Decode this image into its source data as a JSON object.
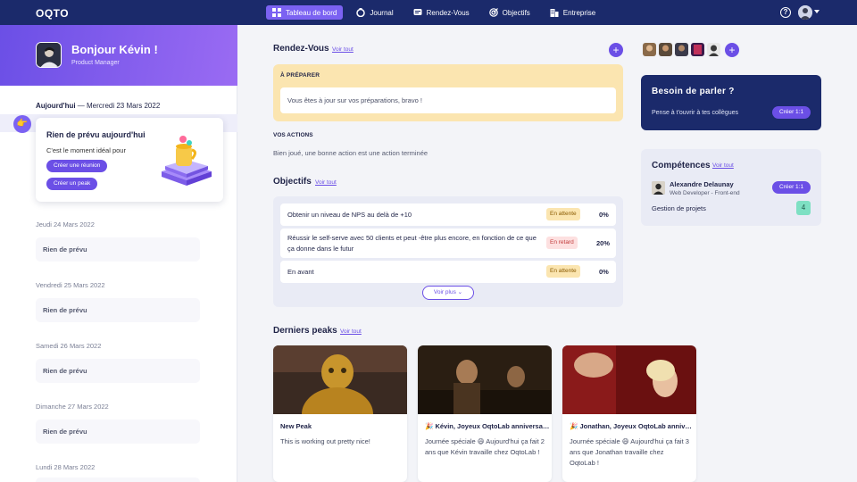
{
  "brand": "OQTO",
  "nav": {
    "items": [
      {
        "label": "Tableau de bord",
        "icon": "dashboard-icon",
        "active": true
      },
      {
        "label": "Journal",
        "icon": "journal-icon"
      },
      {
        "label": "Rendez-Vous",
        "icon": "meeting-icon"
      },
      {
        "label": "Objectifs",
        "icon": "target-icon"
      },
      {
        "label": "Entreprise",
        "icon": "company-icon"
      }
    ],
    "help": "?"
  },
  "hero": {
    "greeting": "Bonjour Kévin !",
    "role": "Product Manager"
  },
  "agenda": {
    "today_prefix": "Aujourd'hui",
    "today_date": " — Mercredi 23 Mars 2022",
    "today_card": {
      "title": "Rien de prévu aujourd'hui",
      "subtitle": "C'est le moment idéal pour",
      "btn_meeting": "Créer une réunion",
      "btn_peak": "Créer un peak"
    },
    "days": [
      {
        "date": "Jeudi 24 Mars 2022",
        "status": "Rien de prévu"
      },
      {
        "date": "Vendredi 25 Mars 2022",
        "status": "Rien de prévu"
      },
      {
        "date": "Samedi 26 Mars 2022",
        "status": "Rien de prévu"
      },
      {
        "date": "Dimanche 27 Mars 2022",
        "status": "Rien de prévu"
      },
      {
        "date": "Lundi 28 Mars 2022",
        "status": ""
      }
    ]
  },
  "rdv": {
    "title": "Rendez-Vous",
    "see_all": "Voir tout",
    "prepare_label": "À PRÉPARER",
    "prepare_text": "Vous êtes à jour sur vos préparations, bravo !",
    "actions_label": "VOS ACTIONS",
    "actions_text": "Bien joué, une bonne action est une action terminée"
  },
  "objectives": {
    "title": "Objectifs",
    "see_all": "Voir tout",
    "rows": [
      {
        "name": "Obtenir un niveau de NPS au delà de +10",
        "status": "En attente",
        "percent": "0%"
      },
      {
        "name": "Réussir le self-serve avec 50 clients et peut -être plus encore, en fonction de ce que ça donne dans le futur",
        "status": "En retard",
        "percent": "20%"
      },
      {
        "name": "En avant",
        "status": "En attente",
        "percent": "0%"
      }
    ],
    "more": "Voir plus"
  },
  "peaks": {
    "title": "Derniers peaks",
    "see_all": "Voir tout",
    "items": [
      {
        "title": "New Peak",
        "emoji": "",
        "text": "This is working out pretty nice!"
      },
      {
        "title": "Kévin, Joyeux OqtoLab anniversaire !",
        "emoji": "🎉",
        "text": "Journée spéciale 😄 Aujourd'hui ça fait 2 ans que Kévin travaille chez OqtoLab !"
      },
      {
        "title": "Jonathan, Joyeux OqtoLab anniversaire !",
        "emoji": "🎉",
        "text": "Journée spéciale 😄 Aujourd'hui ça fait 3 ans que Jonathan travaille chez OqtoLab !"
      }
    ]
  },
  "besoin": {
    "title": "Besoin de parler ?",
    "text": "Pense à t'ouvrir à tes collègues",
    "button": "Créer 1:1"
  },
  "competences": {
    "title": "Compétences",
    "see_all": "Voir tout",
    "person": {
      "name": "Alexandre Delaunay",
      "role": "Web Developer - Front-end",
      "button": "Créer 1:1"
    },
    "skill": {
      "name": "Gestion de projets",
      "count": "4"
    }
  },
  "colors": {
    "accent": "#6b4fe6",
    "nav": "#1b2a6b",
    "warning_bg": "#fbe5b0",
    "late_bg": "#fde0e0",
    "count_bg": "#7ee0c3"
  }
}
